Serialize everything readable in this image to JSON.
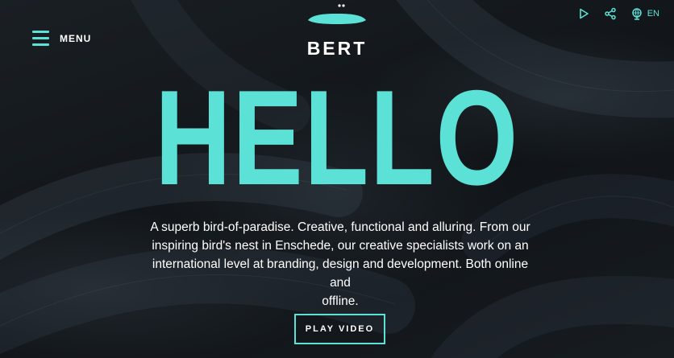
{
  "header": {
    "menu_label": "MENU",
    "logo_text": "BERT",
    "language": "EN",
    "icons": [
      "hamburger-icon",
      "play-icon",
      "share-icon",
      "globe-icon"
    ]
  },
  "hero": {
    "headline": "HELLO",
    "description_lines": [
      "A superb bird-of-paradise. Creative, functional and alluring. From our",
      "inspiring bird's nest in Enschede, our creative specialists work on an",
      "international level at branding, design and development. Both online and",
      "offline."
    ],
    "cta_label": "PLAY VIDEO"
  },
  "colors": {
    "accent": "#5ce1d6",
    "background": "#14181c",
    "text": "#ffffff"
  }
}
